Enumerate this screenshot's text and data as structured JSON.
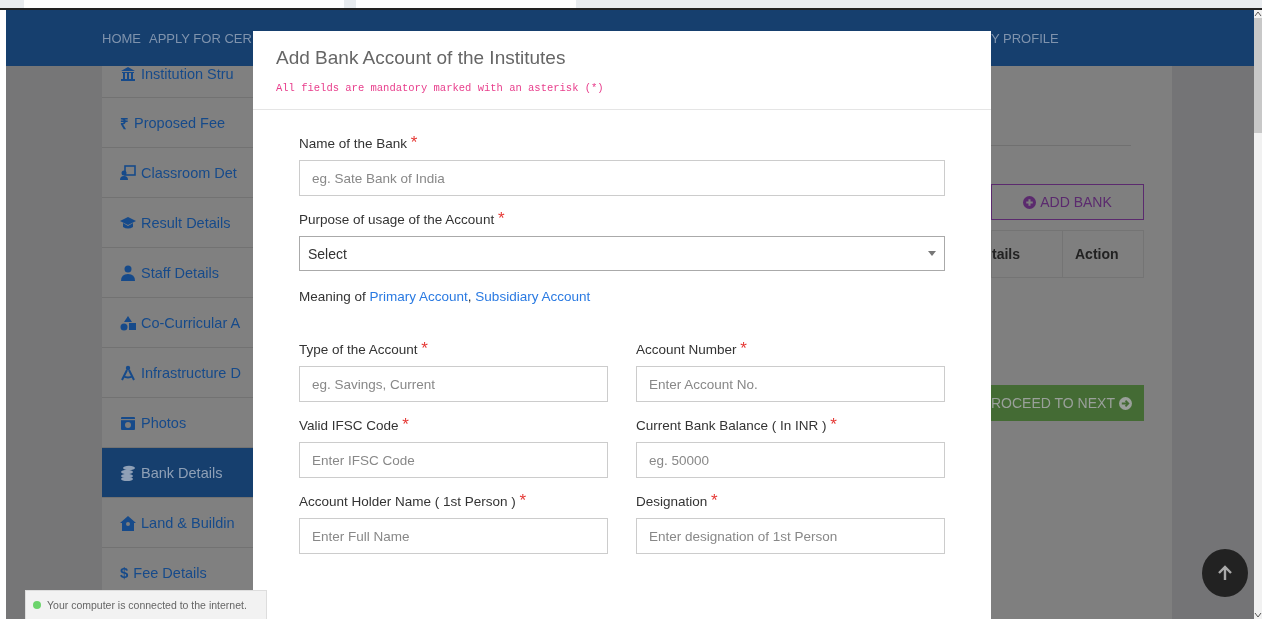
{
  "nav": {
    "items": [
      "HOME",
      "APPLY FOR CER"
    ],
    "profile": "Y PROFILE"
  },
  "sidebar": {
    "items": [
      {
        "label": "Institution Stru",
        "selected": false
      },
      {
        "label": "Proposed Fee",
        "glyph": "₹",
        "selected": false
      },
      {
        "label": "Classroom Det",
        "selected": false
      },
      {
        "label": "Result Details",
        "selected": false
      },
      {
        "label": "Staff Details",
        "selected": false
      },
      {
        "label": "Co-Curricular A",
        "selected": false
      },
      {
        "label": "Infrastructure D",
        "selected": false
      },
      {
        "label": "Photos",
        "selected": false
      },
      {
        "label": "Bank Details",
        "selected": true
      },
      {
        "label": "Land & Buildin",
        "selected": false
      },
      {
        "label": "Fee Details",
        "glyph": "$",
        "selected": false
      }
    ]
  },
  "page": {
    "add_button": "ADD BANK",
    "table_columns": [
      "tails",
      "Action"
    ],
    "next_button": "ROCEED TO NEXT"
  },
  "modal": {
    "title": "Add Bank Account of the Institutes",
    "note": "All fields are mandatory marked with an asterisk (*)",
    "rows": [
      {
        "kind": "fields",
        "fields": [
          {
            "label": "Name of the Bank",
            "mark": "*",
            "kind": "text",
            "placeholder": "eg. Sate Bank of India"
          }
        ]
      },
      {
        "kind": "fields",
        "fields": [
          {
            "label": "Purpose of usage of the Account",
            "mark": "*",
            "kind": "select",
            "value": "Select"
          }
        ]
      },
      {
        "kind": "sentence",
        "parts": [
          {
            "kind": "text",
            "text": "Meaning of "
          },
          {
            "kind": "link",
            "text": "Primary Account"
          },
          {
            "kind": "text",
            "text": ", "
          },
          {
            "kind": "link",
            "text": "Subsidiary Account"
          }
        ]
      },
      {
        "kind": "fields",
        "fields": [
          {
            "label": "Type of the Account",
            "mark": "*",
            "kind": "text",
            "placeholder": "eg. Savings, Current"
          },
          {
            "label": "Account Number",
            "mark": "*",
            "kind": "text",
            "placeholder": "Enter Account No."
          }
        ]
      },
      {
        "kind": "fields",
        "fields": [
          {
            "label": "Valid IFSC Code",
            "mark": "*",
            "kind": "text",
            "placeholder": "Enter IFSC Code"
          },
          {
            "label": "Current Bank Balance ( In INR )",
            "mark": "*",
            "kind": "text",
            "placeholder": "eg. 50000"
          }
        ]
      },
      {
        "kind": "fields",
        "fields": [
          {
            "label": "Account Holder Name ( 1st Person )",
            "mark": "*",
            "kind": "text",
            "placeholder": "Enter Full Name"
          },
          {
            "label": "Designation",
            "mark": "*",
            "kind": "text",
            "placeholder": "Enter designation of 1st Person"
          }
        ]
      }
    ]
  },
  "toast": {
    "text": "Your computer is connected to the internet."
  }
}
